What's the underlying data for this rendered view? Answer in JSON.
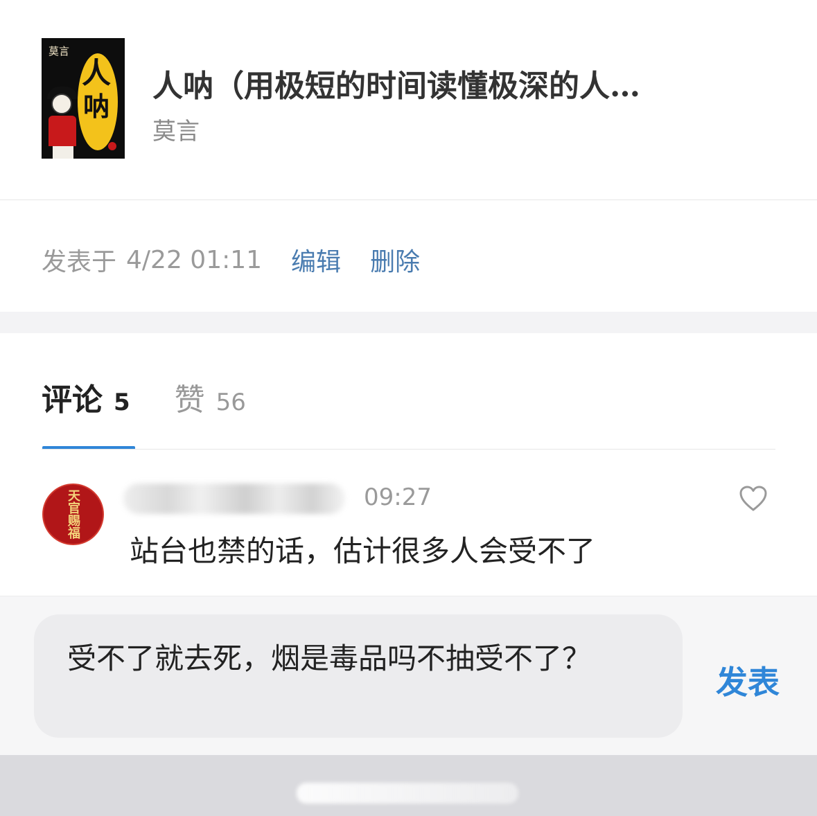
{
  "book": {
    "title": "人呐（用极短的时间读懂极深的人…",
    "author": "莫言",
    "cover": {
      "author_text": "莫言",
      "title_char_1": "人",
      "title_char_2": "呐"
    }
  },
  "meta": {
    "posted_label": "发表于",
    "posted_time": "4/22 01:11",
    "edit_label": "编辑",
    "delete_label": "删除"
  },
  "tabs": [
    {
      "label": "评论",
      "count": "5",
      "active": true
    },
    {
      "label": "赞",
      "count": "56",
      "active": false
    }
  ],
  "comment": {
    "avatar_text": "天官赐福",
    "time": "09:27",
    "text": "站台也禁的话，估计很多人会受不了",
    "like_icon": "heart-outline-icon"
  },
  "reply": {
    "draft_text": "受不了就去死，烟是毒品吗不抽受不了？",
    "publish_label": "发表"
  },
  "colors": {
    "accent_blue": "#2f86d8",
    "link_blue": "#4a7cb0",
    "muted_gray": "#9a9a9a"
  }
}
